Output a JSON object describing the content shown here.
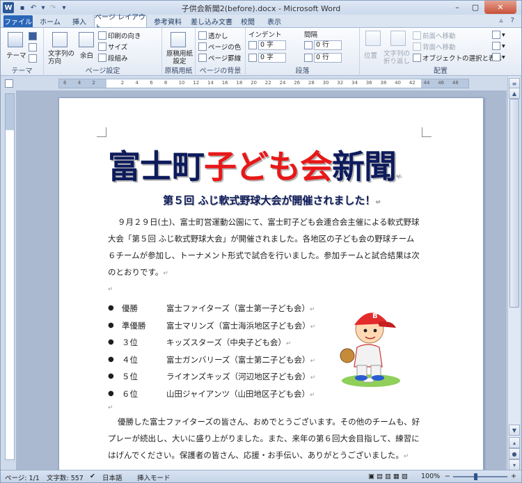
{
  "window": {
    "title": "子供会新聞2(before).docx - Microsoft Word",
    "app_icon": "W",
    "controls": {
      "minimize": "–",
      "maximize": "▢",
      "close": "✕"
    }
  },
  "tabs": [
    {
      "label": "ファイル"
    },
    {
      "label": "ホーム"
    },
    {
      "label": "挿入"
    },
    {
      "label": "ページ レイアウト"
    },
    {
      "label": "参考資料"
    },
    {
      "label": "差し込み文書"
    },
    {
      "label": "校閲"
    },
    {
      "label": "表示"
    }
  ],
  "ribbon": {
    "theme": {
      "label": "テーマ",
      "button": "テーマ"
    },
    "page_setup": {
      "label": "ページ設定",
      "text_direction": "文字列の方向",
      "margins": "余白",
      "orientation": "印刷の向き",
      "size": "サイズ",
      "columns": "段組み"
    },
    "manuscript": {
      "label": "原稿用紙",
      "button": "原稿用紙設定"
    },
    "page_background": {
      "label": "ページの背景",
      "watermark": "透かし",
      "page_color": "ページの色",
      "page_borders": "ページ罫線"
    },
    "paragraph": {
      "label": "段落",
      "indent": "インデント",
      "spacing": "間隔",
      "indent_left": "0 字",
      "indent_right": "0 字",
      "space_before": "0 行",
      "space_after": "0 行"
    },
    "arrange": {
      "label": "配置",
      "position": "位置",
      "wrap": "文字列の折り返し",
      "bring_forward": "前面へ移動",
      "send_backward": "背面へ移動",
      "selection_pane": "オブジェクトの選択と表示"
    }
  },
  "ruler": {
    "ticks": [
      "6",
      "4",
      "2",
      "",
      "2",
      "4",
      "6",
      "8",
      "10",
      "12",
      "14",
      "16",
      "18",
      "20",
      "22",
      "24",
      "26",
      "28",
      "30",
      "32",
      "34",
      "36",
      "38",
      "40",
      "42",
      "44",
      "46",
      "48"
    ]
  },
  "document": {
    "masthead": {
      "part1": "富士町",
      "part2": "子ども会",
      "part3": "新聞"
    },
    "subheadline": "第５回 ふじ軟式野球大会が開催されました！",
    "para1": "９月２９日(土)、富士町営運動公園にて、富士町子ども会連合会主催による軟式野球大会「第５回 ふじ軟式野球大会」が開催されました。各地区の子ども会の野球チーム ６チームが参加し、トーナメント形式で試合を行いました。参加チームと試合結果は次のとおりです。",
    "results": [
      {
        "rank": "優勝",
        "team": "富士ファイターズ（富士第一子ども会）"
      },
      {
        "rank": "準優勝",
        "team": "富士マリンズ（富士海浜地区子ども会）"
      },
      {
        "rank": "３位",
        "team": "キッズスターズ（中央子ども会）"
      },
      {
        "rank": "４位",
        "team": "富士ガンバリーズ（富士第二子ども会）"
      },
      {
        "rank": "５位",
        "team": "ライオンズキッズ（河辺地区子ども会）"
      },
      {
        "rank": "６位",
        "team": "山田ジャイアンツ（山田地区子ども会）"
      }
    ],
    "para2": "優勝した富士ファイターズの皆さん、おめでとうございます。その他のチームも、好プレーが続出し、大いに盛り上がりました。また、来年の第６回大会目指して、練習にはげんでください。保護者の皆さん、応援・お手伝い、ありがとうございました。",
    "mark": "↵",
    "image_icon": "baseball-player-clipart"
  },
  "status": {
    "page": "ページ: 1/1",
    "words": "文字数: 557",
    "language": "日本語",
    "mode": "挿入モード",
    "zoom": "100%"
  },
  "colors": {
    "title_navy": "#0d1b5c",
    "title_red": "#e81818",
    "file_tab": "#2a66b8"
  }
}
